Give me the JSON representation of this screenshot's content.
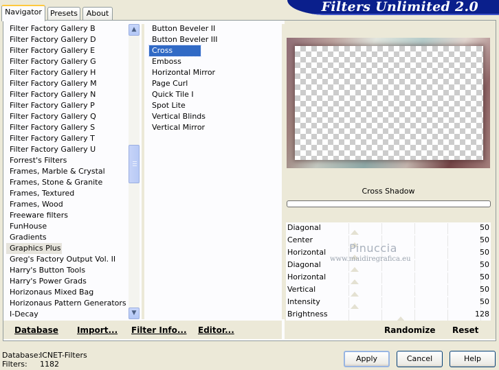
{
  "tabs": [
    "Navigator",
    "Presets",
    "About"
  ],
  "banner_title": "Filters Unlimited 2.0",
  "categories": [
    "Filter Factory Gallery B",
    "Filter Factory Gallery D",
    "Filter Factory Gallery E",
    "Filter Factory Gallery G",
    "Filter Factory Gallery H",
    "Filter Factory Gallery M",
    "Filter Factory Gallery N",
    "Filter Factory Gallery P",
    "Filter Factory Gallery Q",
    "Filter Factory Gallery S",
    "Filter Factory Gallery T",
    "Filter Factory Gallery U",
    "Forrest's Filters",
    "Frames, Marble & Crystal",
    "Frames, Stone & Granite",
    "Frames, Textured",
    "Frames, Wood",
    "Freeware filters",
    "FunHouse",
    "Gradients",
    "Graphics Plus",
    "Greg's Factory Output Vol. II",
    "Harry's Button Tools",
    "Harry's Power Grads",
    "Horizonaus Mixed Bag",
    "Horizonaus Pattern Generators",
    "I-Decay"
  ],
  "selected_category": "Graphics Plus",
  "filters": [
    "Button Beveler II",
    "Button Beveler III",
    "Cross Shadow",
    "Emboss",
    "Horizontal Mirror",
    "Page Curl",
    "Quick Tile I",
    "Spot Lite",
    "Vertical Blinds",
    "Vertical Mirror"
  ],
  "selected_filter": "Cross Shadow",
  "filter_name_label": "Cross Shadow",
  "params": [
    {
      "label": "Diagonal",
      "value": "50"
    },
    {
      "label": "Center",
      "value": "50"
    },
    {
      "label": "Horizontal",
      "value": "50"
    },
    {
      "label": "Diagonal",
      "value": "50"
    },
    {
      "label": "Horizontal",
      "value": "50"
    },
    {
      "label": "Vertical",
      "value": "50"
    },
    {
      "label": "Intensity",
      "value": "50"
    },
    {
      "label": "Brightness",
      "value": "128"
    }
  ],
  "param_max": 255,
  "watermark": {
    "name": "Pinuccia",
    "url": "www.maidiregrafica.eu"
  },
  "left_bar": {
    "database": "Database",
    "import": "Import...",
    "filter_info": "Filter Info...",
    "editor": "Editor..."
  },
  "right_bar": {
    "randomize": "Randomize",
    "reset": "Reset"
  },
  "status": {
    "database_label": "Database:",
    "database_value": "ICNET-Filters",
    "filters_label": "Filters:",
    "filters_value": "1182"
  },
  "buttons": {
    "apply": "Apply",
    "cancel": "Cancel",
    "help": "Help"
  },
  "colors": {
    "banner": "#0a1f8c",
    "selection": "#316ac5",
    "window": "#ece9d8"
  }
}
